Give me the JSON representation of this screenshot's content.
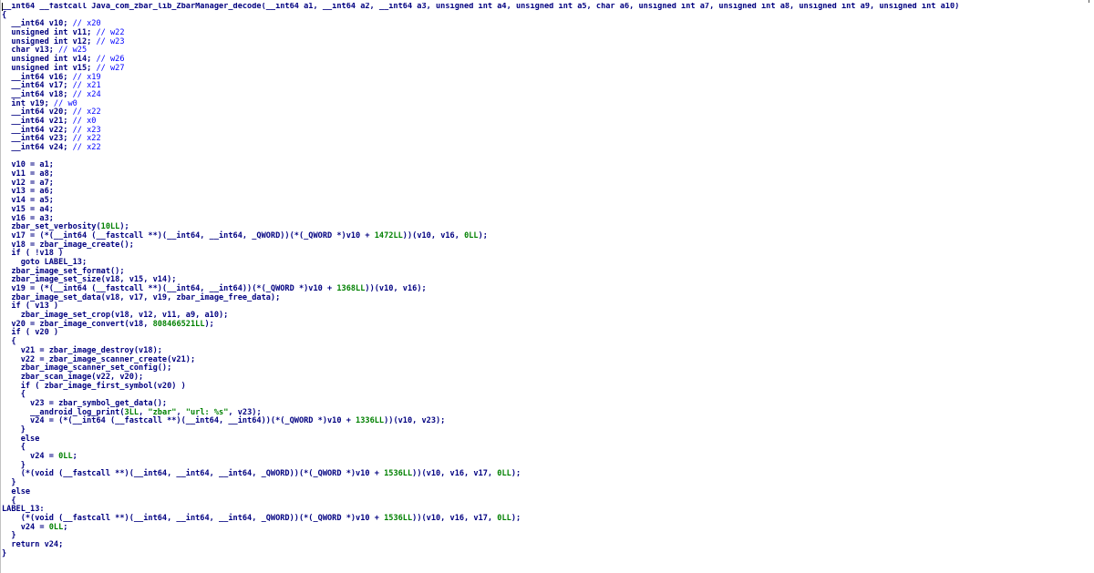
{
  "code_lines": [
    [
      [
        "plain",
        "__int64 __fastcall Java_com_zbar_lib_ZbarManager_decode(__int64 a1, __int64 a2, __int64 a3, unsigned int a4, unsigned int a5, char a6, unsigned int a7, unsigned int a8, unsigned int a9, unsigned int a10)"
      ]
    ],
    [
      [
        "plain",
        "{"
      ]
    ],
    [
      [
        "plain",
        "  __int64 v10; "
      ],
      [
        "cmt",
        "// x20"
      ]
    ],
    [
      [
        "plain",
        "  unsigned int v11; "
      ],
      [
        "cmt",
        "// w22"
      ]
    ],
    [
      [
        "plain",
        "  unsigned int v12; "
      ],
      [
        "cmt",
        "// w23"
      ]
    ],
    [
      [
        "plain",
        "  char v13; "
      ],
      [
        "cmt",
        "// w25"
      ]
    ],
    [
      [
        "plain",
        "  unsigned int v14; "
      ],
      [
        "cmt",
        "// w26"
      ]
    ],
    [
      [
        "plain",
        "  unsigned int v15; "
      ],
      [
        "cmt",
        "// w27"
      ]
    ],
    [
      [
        "plain",
        "  __int64 v16; "
      ],
      [
        "cmt",
        "// x19"
      ]
    ],
    [
      [
        "plain",
        "  __int64 v17; "
      ],
      [
        "cmt",
        "// x21"
      ]
    ],
    [
      [
        "plain",
        "  __int64 v18; "
      ],
      [
        "cmt",
        "// x24"
      ]
    ],
    [
      [
        "plain",
        "  int v19; "
      ],
      [
        "cmt",
        "// w0"
      ]
    ],
    [
      [
        "plain",
        "  __int64 v20; "
      ],
      [
        "cmt",
        "// x22"
      ]
    ],
    [
      [
        "plain",
        "  __int64 v21; "
      ],
      [
        "cmt",
        "// x0"
      ]
    ],
    [
      [
        "plain",
        "  __int64 v22; "
      ],
      [
        "cmt",
        "// x23"
      ]
    ],
    [
      [
        "plain",
        "  __int64 v23; "
      ],
      [
        "cmt",
        "// x22"
      ]
    ],
    [
      [
        "plain",
        "  __int64 v24; "
      ],
      [
        "cmt",
        "// x22"
      ]
    ],
    [
      [
        "plain",
        ""
      ]
    ],
    [
      [
        "plain",
        "  v10 = a1;"
      ]
    ],
    [
      [
        "plain",
        "  v11 = a8;"
      ]
    ],
    [
      [
        "plain",
        "  v12 = a7;"
      ]
    ],
    [
      [
        "plain",
        "  v13 = a6;"
      ]
    ],
    [
      [
        "plain",
        "  v14 = a5;"
      ]
    ],
    [
      [
        "plain",
        "  v15 = a4;"
      ]
    ],
    [
      [
        "plain",
        "  v16 = a3;"
      ]
    ],
    [
      [
        "plain",
        "  zbar_set_verbosity("
      ],
      [
        "num",
        "10LL"
      ],
      [
        "plain",
        ");"
      ]
    ],
    [
      [
        "plain",
        "  v17 = (*(__int64 (__fastcall **)(__int64, __int64, _QWORD))(*(_QWORD *)v10 + "
      ],
      [
        "num",
        "1472LL"
      ],
      [
        "plain",
        "))(v10, v16, "
      ],
      [
        "num",
        "0LL"
      ],
      [
        "plain",
        ");"
      ]
    ],
    [
      [
        "plain",
        "  v18 = zbar_image_create();"
      ]
    ],
    [
      [
        "plain",
        "  if ( !v18 )"
      ]
    ],
    [
      [
        "plain",
        "    goto LABEL_13;"
      ]
    ],
    [
      [
        "plain",
        "  zbar_image_set_format();"
      ]
    ],
    [
      [
        "plain",
        "  zbar_image_set_size(v18, v15, v14);"
      ]
    ],
    [
      [
        "plain",
        "  v19 = (*(__int64 (__fastcall **)(__int64, __int64))(*(_QWORD *)v10 + "
      ],
      [
        "num",
        "1368LL"
      ],
      [
        "plain",
        "))(v10, v16);"
      ]
    ],
    [
      [
        "plain",
        "  zbar_image_set_data(v18, v17, v19, zbar_image_free_data);"
      ]
    ],
    [
      [
        "plain",
        "  if ( v13 )"
      ]
    ],
    [
      [
        "plain",
        "    zbar_image_set_crop(v18, v12, v11, a9, a10);"
      ]
    ],
    [
      [
        "plain",
        "  v20 = zbar_image_convert(v18, "
      ],
      [
        "num",
        "808466521LL"
      ],
      [
        "plain",
        ");"
      ]
    ],
    [
      [
        "plain",
        "  if ( v20 )"
      ]
    ],
    [
      [
        "plain",
        "  {"
      ]
    ],
    [
      [
        "plain",
        "    v21 = zbar_image_destroy(v18);"
      ]
    ],
    [
      [
        "plain",
        "    v22 = zbar_image_scanner_create(v21);"
      ]
    ],
    [
      [
        "plain",
        "    zbar_image_scanner_set_config();"
      ]
    ],
    [
      [
        "plain",
        "    zbar_scan_image(v22, v20);"
      ]
    ],
    [
      [
        "plain",
        "    if ( zbar_image_first_symbol(v20) )"
      ]
    ],
    [
      [
        "plain",
        "    {"
      ]
    ],
    [
      [
        "plain",
        "      v23 = zbar_symbol_get_data();"
      ]
    ],
    [
      [
        "plain",
        "      __android_log_print("
      ],
      [
        "num",
        "3LL"
      ],
      [
        "plain",
        ", "
      ],
      [
        "str",
        "\"zbar\""
      ],
      [
        "plain",
        ", "
      ],
      [
        "str",
        "\"url: %s\""
      ],
      [
        "plain",
        ", v23);"
      ]
    ],
    [
      [
        "plain",
        "      v24 = (*(__int64 (__fastcall **)(__int64, __int64))(*(_QWORD *)v10 + "
      ],
      [
        "num",
        "1336LL"
      ],
      [
        "plain",
        "))(v10, v23);"
      ]
    ],
    [
      [
        "plain",
        "    }"
      ]
    ],
    [
      [
        "plain",
        "    else"
      ]
    ],
    [
      [
        "plain",
        "    {"
      ]
    ],
    [
      [
        "plain",
        "      v24 = "
      ],
      [
        "num",
        "0LL"
      ],
      [
        "plain",
        ";"
      ]
    ],
    [
      [
        "plain",
        "    }"
      ]
    ],
    [
      [
        "plain",
        "    (*(void (__fastcall **)(__int64, __int64, __int64, _QWORD))(*(_QWORD *)v10 + "
      ],
      [
        "num",
        "1536LL"
      ],
      [
        "plain",
        "))(v10, v16, v17, "
      ],
      [
        "num",
        "0LL"
      ],
      [
        "plain",
        ");"
      ]
    ],
    [
      [
        "plain",
        "  }"
      ]
    ],
    [
      [
        "plain",
        "  else"
      ]
    ],
    [
      [
        "plain",
        "  {"
      ]
    ],
    [
      [
        "plain",
        "LABEL_13:"
      ]
    ],
    [
      [
        "plain",
        "    (*(void (__fastcall **)(__int64, __int64, __int64, _QWORD))(*(_QWORD *)v10 + "
      ],
      [
        "num",
        "1536LL"
      ],
      [
        "plain",
        "))(v10, v16, v17, "
      ],
      [
        "num",
        "0LL"
      ],
      [
        "plain",
        ");"
      ]
    ],
    [
      [
        "plain",
        "    v24 = "
      ],
      [
        "num",
        "0LL"
      ],
      [
        "plain",
        ";"
      ]
    ],
    [
      [
        "plain",
        "  }"
      ]
    ],
    [
      [
        "plain",
        "  return v24;"
      ]
    ],
    [
      [
        "plain",
        "}"
      ]
    ]
  ],
  "colors": {
    "plain": "#000080",
    "comment": "#0000ff",
    "number": "#008000",
    "string": "#008000",
    "background": "#ffffff"
  }
}
